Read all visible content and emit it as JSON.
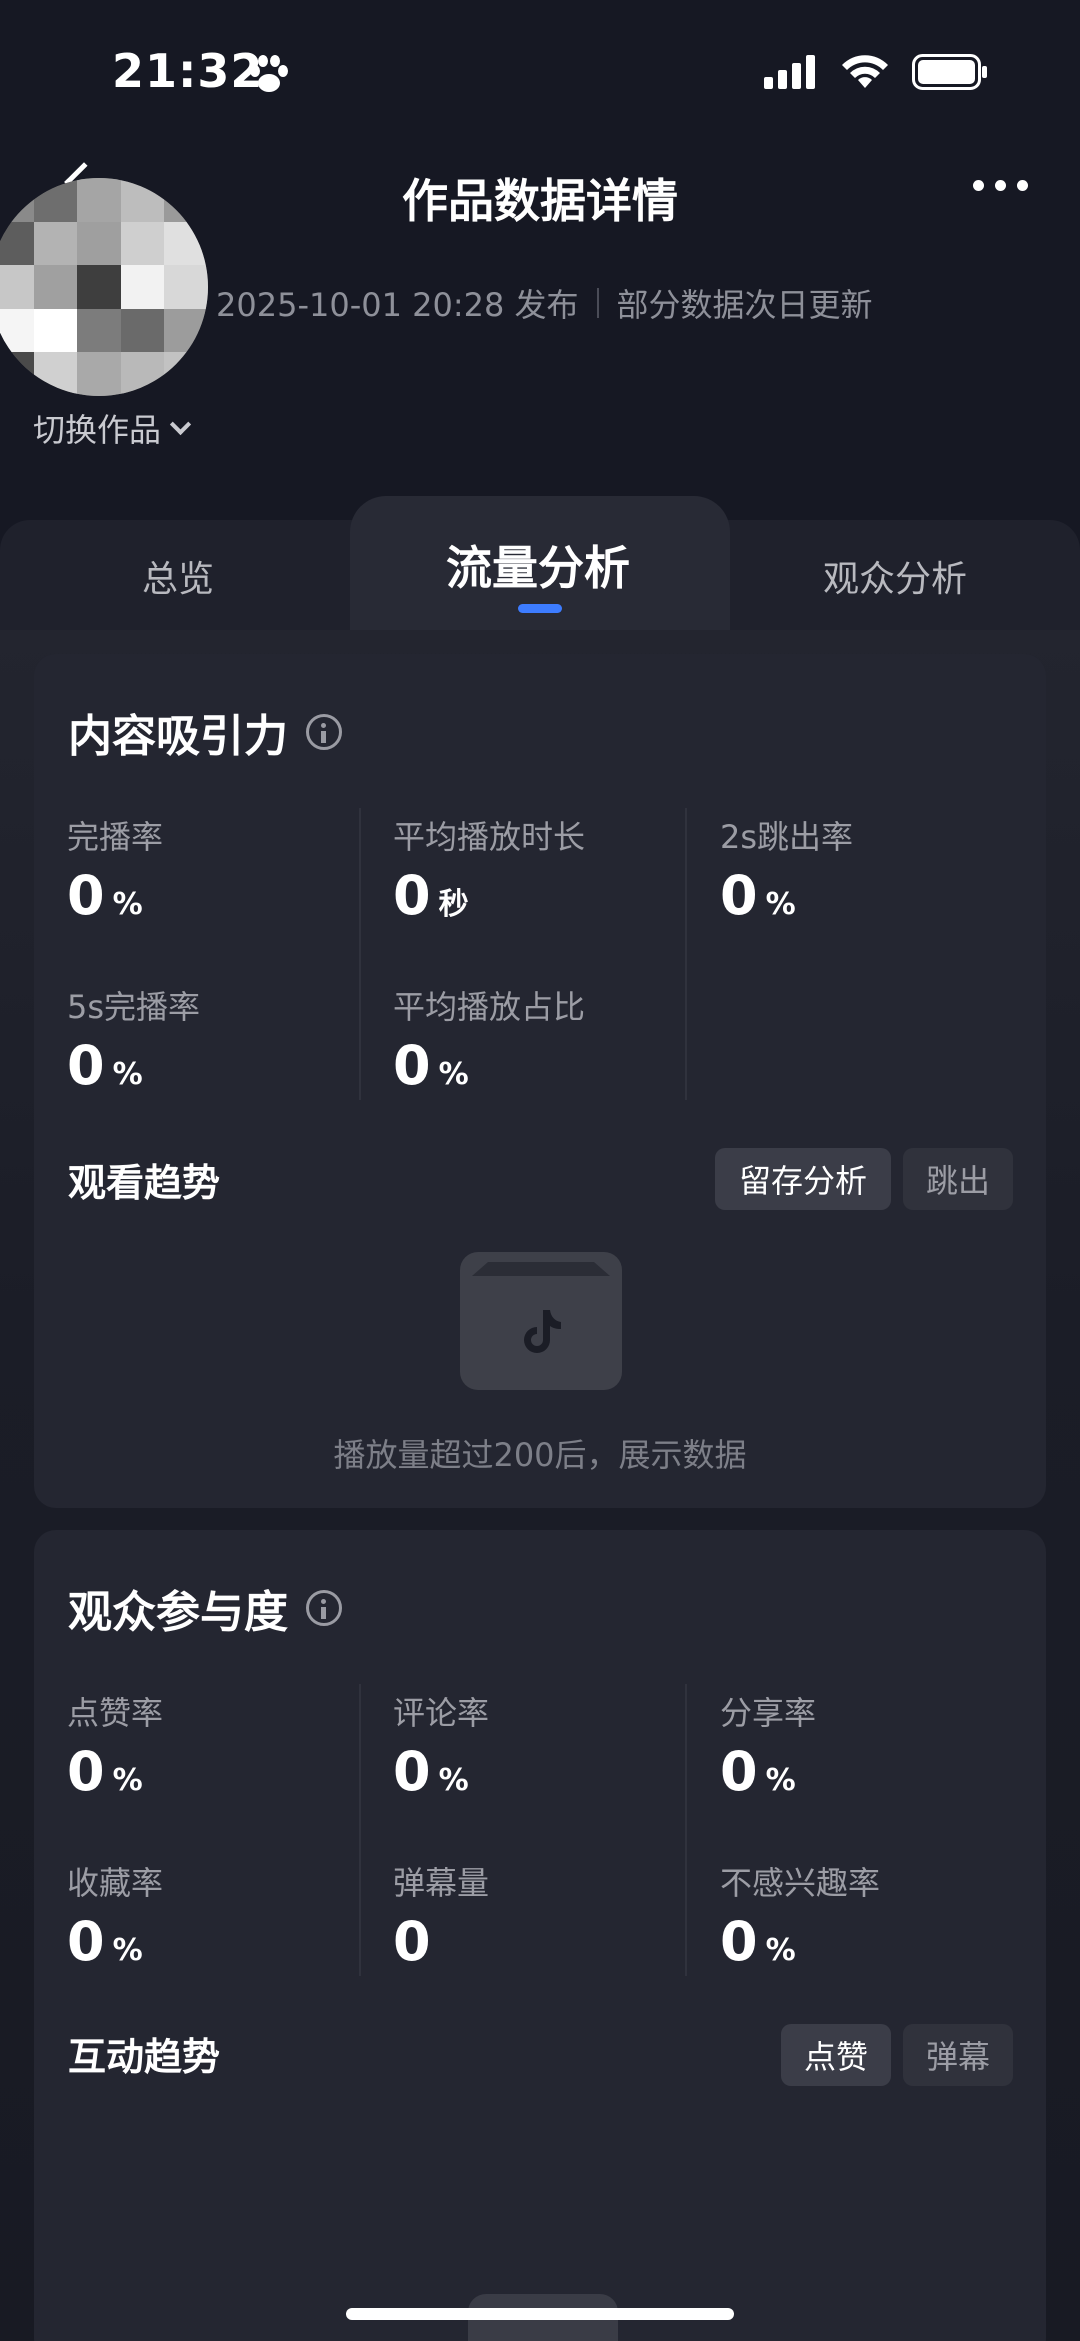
{
  "status_bar": {
    "time": "21:32"
  },
  "header": {
    "title": "作品数据详情",
    "publish_time": "2025-10-01 20:28 发布",
    "update_note": "部分数据次日更新",
    "switch_label": "切换作品"
  },
  "tabs": [
    {
      "label": "总览",
      "active": false
    },
    {
      "label": "流量分析",
      "active": true
    },
    {
      "label": "观众分析",
      "active": false
    }
  ],
  "content_attraction": {
    "title": "内容吸引力",
    "metrics": [
      {
        "label": "完播率",
        "value": "0",
        "unit": "%"
      },
      {
        "label": "平均播放时长",
        "value": "0",
        "unit": "秒"
      },
      {
        "label": "2s跳出率",
        "value": "0",
        "unit": "%"
      },
      {
        "label": "5s完播率",
        "value": "0",
        "unit": "%"
      },
      {
        "label": "平均播放占比",
        "value": "0",
        "unit": "%"
      }
    ],
    "trend_title": "观看趋势",
    "trend_buttons": [
      {
        "label": "留存分析",
        "active": true
      },
      {
        "label": "跳出",
        "active": false
      }
    ],
    "empty_text": "播放量超过200后，展示数据"
  },
  "audience_engagement": {
    "title": "观众参与度",
    "metrics": [
      {
        "label": "点赞率",
        "value": "0",
        "unit": "%"
      },
      {
        "label": "评论率",
        "value": "0",
        "unit": "%"
      },
      {
        "label": "分享率",
        "value": "0",
        "unit": "%"
      },
      {
        "label": "收藏率",
        "value": "0",
        "unit": "%"
      },
      {
        "label": "弹幕量",
        "value": "0",
        "unit": ""
      },
      {
        "label": "不感兴趣率",
        "value": "0",
        "unit": "%"
      }
    ],
    "trend_title": "互动趋势",
    "trend_buttons": [
      {
        "label": "点赞",
        "active": true
      },
      {
        "label": "弹幕",
        "active": false
      }
    ]
  },
  "colors": {
    "background": "#161823",
    "card": "#242631",
    "accent": "#3d7cff",
    "muted_text": "#9c9da5"
  }
}
